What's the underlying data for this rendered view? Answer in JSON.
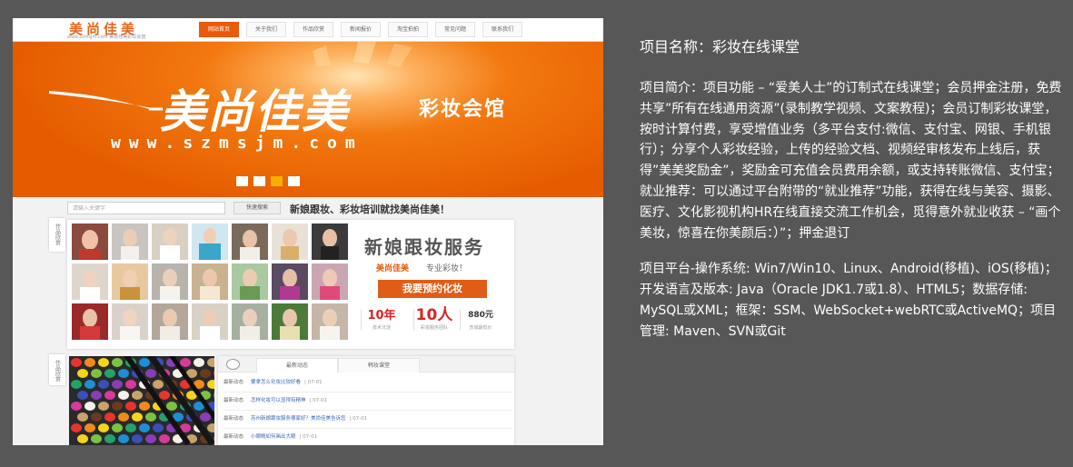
{
  "screenshot": {
    "logo_text": "美尚佳美",
    "logo_subtitle": "www.szmsjm.com 美尚佳美彩妆会馆",
    "nav": [
      "网站首页",
      "关于我们",
      "作品欣赏",
      "新闻报价",
      "淘宝拍拍",
      "常见问题",
      "联系我们"
    ],
    "nav_active_index": 0,
    "banner": {
      "title": "美尚佳美",
      "subtitle": "彩妆会馆",
      "url": "www.szmsjm.com",
      "slide_count": 4,
      "active_slide_index": 2
    },
    "search": {
      "placeholder": "请输入关键字",
      "button_label": "快速搜索"
    },
    "slogan": "新娘跟妆、彩妆培训就找美尚佳美！",
    "side_tab_1": "作品欣赏",
    "side_tab_2": "作品欣赏",
    "bridal": {
      "title": "新娘跟妆服务",
      "brand": "美尚佳美",
      "tagline": "专业彩妆！",
      "button_label": "我要预约化妆",
      "stats": [
        {
          "value": "10年",
          "caption": "技术沉淀"
        },
        {
          "value": "10人",
          "caption": "彩妆服务团队"
        },
        {
          "value": "880元",
          "caption": "苏城最低价"
        }
      ]
    },
    "news": {
      "tabs": [
        "最新动态",
        "韩妆课堂"
      ],
      "items": [
        {
          "category": "最新动态",
          "title": "要拿怎么化妆比较好看",
          "date": "| 07-01"
        },
        {
          "category": "最新动态",
          "title": "怎样化妆可以显得有精神",
          "date": "| 07-01"
        },
        {
          "category": "最新动态",
          "title": "苏州新娘跟妆服务哪家好？美尚佳美告诉您",
          "date": "| 07-01"
        },
        {
          "category": "最新动态",
          "title": "小眼睛如何画出大眼",
          "date": "| 07-01"
        }
      ]
    }
  },
  "description": {
    "title": "项目名称：彩妆在线课堂",
    "intro": "项目简介：项目功能 – “爱美人士”的订制式在线课堂；会员押金注册，免费共享”所有在线通用资源”(录制教学视频、文案教程)；会员订制彩妆课堂，按时计算付费，享受增值业务（多平台支付:微信、支付宝、网银、手机银行）；分享个人彩妆经验，上传的经验文档、视频经审核发布上线后，获得”美美奖励金”，奖励金可充值会员费用余额，或支持转账微信、支付宝；就业推荐：可以通过平台附带的“就业推荐”功能，获得在线与美容、摄影、医疗、文化影视机构HR在线直接交流工作机会，觅得意外就业收获 – “画个美妆，惊喜在你美颜后：）”；押金退订",
    "platform": "项目平台-操作系统: Win7/Win10、Linux、Android(移植)、iOS(移植)；开发语言及版本: Java（Oracle JDK1.7或1.8）、HTML5；数据存储: MySQL或XML；框架：SSM、WebSocket+webRTC或ActiveMQ；项目管理: Maven、SVN或Git"
  },
  "colors": {
    "accent": "#e85b0c",
    "banner_orange": "#f2780f",
    "dot_active": "#f6b000",
    "page_background": "#575757"
  }
}
